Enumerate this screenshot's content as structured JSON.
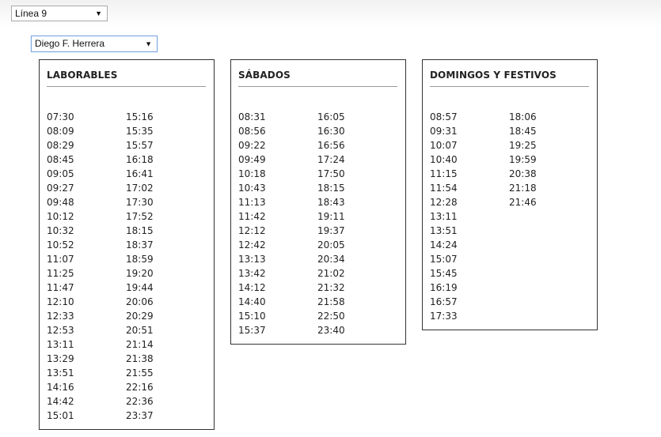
{
  "line_select": {
    "value": "Línea 9"
  },
  "stop_select": {
    "value": "Diego F. Herrera"
  },
  "panels": [
    {
      "title": "LABORABLES",
      "col1": [
        "07:30",
        "08:09",
        "08:29",
        "08:45",
        "09:05",
        "09:27",
        "09:48",
        "10:12",
        "10:32",
        "10:52",
        "11:07",
        "11:25",
        "11:47",
        "12:10",
        "12:33",
        "12:53",
        "13:11",
        "13:29",
        "13:51",
        "14:16",
        "14:42",
        "15:01"
      ],
      "col2": [
        "15:16",
        "15:35",
        "15:57",
        "16:18",
        "16:41",
        "17:02",
        "17:30",
        "17:52",
        "18:15",
        "18:37",
        "18:59",
        "19:20",
        "19:44",
        "20:06",
        "20:29",
        "20:51",
        "21:14",
        "21:38",
        "21:55",
        "22:16",
        "22:36",
        "23:37"
      ]
    },
    {
      "title": "SÁBADOS",
      "col1": [
        "08:31",
        "08:56",
        "09:22",
        "09:49",
        "10:18",
        "10:43",
        "11:13",
        "11:42",
        "12:12",
        "12:42",
        "13:13",
        "13:42",
        "14:12",
        "14:40",
        "15:10",
        "15:37"
      ],
      "col2": [
        "16:05",
        "16:30",
        "16:56",
        "17:24",
        "17:50",
        "18:15",
        "18:43",
        "19:11",
        "19:37",
        "20:05",
        "20:34",
        "21:02",
        "21:32",
        "21:58",
        "22:50",
        "23:40"
      ]
    },
    {
      "title": "DOMINGOS Y FESTIVOS",
      "col1": [
        "08:57",
        "09:31",
        "10:07",
        "10:40",
        "11:15",
        "11:54",
        "12:28",
        "13:11",
        "13:51",
        "14:24",
        "15:07",
        "15:45",
        "16:19",
        "16:57",
        "17:33"
      ],
      "col2": [
        "18:06",
        "18:45",
        "19:25",
        "19:59",
        "20:38",
        "21:18",
        "21:46"
      ]
    }
  ]
}
